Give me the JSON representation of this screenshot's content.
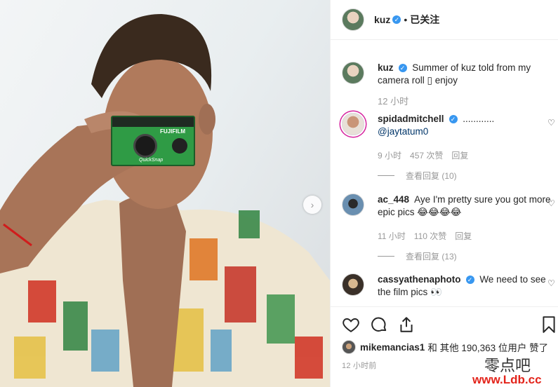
{
  "post": {
    "username": "kuz",
    "follow_status": "已关注",
    "caption": "Summer of kuz told from my camera roll ▯ enjoy",
    "caption_time": "12 小时",
    "timestamp": "12 小时前"
  },
  "comments": [
    {
      "username": "spidadmitchell",
      "verified": true,
      "text": "............",
      "mention": "@jaytatum0",
      "time": "9 小时",
      "likes": "457 次赞",
      "reply": "回复",
      "view_replies": "查看回复 (10)"
    },
    {
      "username": "ac_448",
      "verified": false,
      "text": "Aye I'm pretty sure you got more epic pics 😂😂😂😂",
      "time": "11 小时",
      "likes": "110 次赞",
      "reply": "回复",
      "view_replies": "查看回复 (13)"
    },
    {
      "username": "cassyathenaphoto",
      "verified": true,
      "text": "We need to see the film pics 👀"
    }
  ],
  "likes_line": {
    "user": "mikemancias1",
    "rest": "和 其他 190,363 位用户 赞了"
  },
  "camera": {
    "brand": "FUJIFILM",
    "model": "QuickSnap"
  },
  "watermark": {
    "line1": "零点吧",
    "line2": "www.Ldb.cc"
  },
  "colors": {
    "verified": "#3897f0",
    "watermark_red": "#e3241b",
    "camera_green": "#2f9b45"
  }
}
